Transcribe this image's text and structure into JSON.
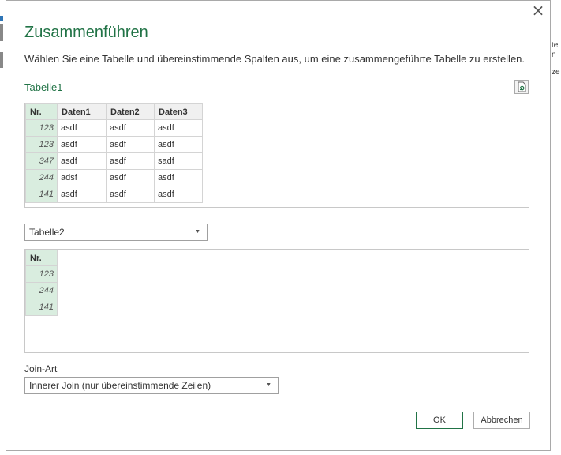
{
  "dialog": {
    "title": "Zusammenführen",
    "description": "Wählen Sie eine Tabelle und übereinstimmende Spalten aus, um eine zusammengeführte Tabelle zu erstellen.",
    "close_symbol": "×"
  },
  "table1": {
    "label": "Tabelle1",
    "refresh_icon": "refresh-table-icon",
    "columns": [
      "Nr.",
      "Daten1",
      "Daten2",
      "Daten3"
    ],
    "rows": [
      [
        "123",
        "asdf",
        "asdf",
        "asdf"
      ],
      [
        "123",
        "asdf",
        "asdf",
        "asdf"
      ],
      [
        "347",
        "asdf",
        "asdf",
        "sadf"
      ],
      [
        "244",
        "adsf",
        "asdf",
        "asdf"
      ],
      [
        "141",
        "asdf",
        "asdf",
        "asdf"
      ]
    ]
  },
  "table2": {
    "selected": "Tabelle2",
    "columns": [
      "Nr."
    ],
    "rows": [
      [
        "123"
      ],
      [
        "244"
      ],
      [
        "141"
      ]
    ]
  },
  "join": {
    "label": "Join-Art",
    "selected": "Innerer Join (nur übereinstimmende Zeilen)"
  },
  "buttons": {
    "ok": "OK",
    "cancel": "Abbrechen"
  },
  "background": {
    "right_fragment_1": "te",
    "right_fragment_2": "n",
    "right_fragment_3": "ze"
  },
  "colors": {
    "accent": "#217346",
    "selected_column": "#d9eddf"
  }
}
